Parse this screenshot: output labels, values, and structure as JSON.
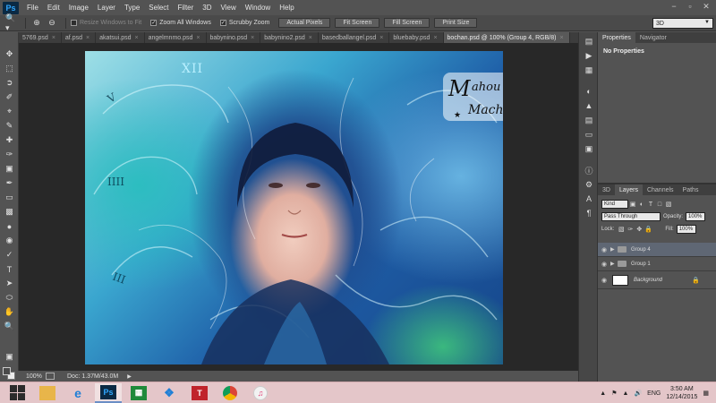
{
  "app": {
    "logo": "Ps",
    "menu": [
      "File",
      "Edit",
      "Image",
      "Layer",
      "Type",
      "Select",
      "Filter",
      "3D",
      "View",
      "Window",
      "Help"
    ],
    "window_controls": [
      "−",
      "▫",
      "✕"
    ]
  },
  "options_bar": {
    "resize_windows": "Resize Windows to Fit",
    "zoom_all_windows": "Zoom All Windows",
    "scrubby_zoom": "Scrubby Zoom",
    "actual_pixels": "Actual Pixels",
    "fit_screen": "Fit Screen",
    "fill_screen": "Fill Screen",
    "print_size": "Print Size",
    "workspace": "3D"
  },
  "tabs": [
    {
      "label": "5769.psd"
    },
    {
      "label": "af.psd"
    },
    {
      "label": "akatsui.psd"
    },
    {
      "label": "angelmnmo.psd"
    },
    {
      "label": "babynino.psd"
    },
    {
      "label": "babynino2.psd"
    },
    {
      "label": "basedballangel.psd"
    },
    {
      "label": "bluebaby.psd"
    },
    {
      "label": "bochan.psd @ 100% (Group 4, RGB/8)",
      "active": true
    }
  ],
  "artwork": {
    "numeral": "XII",
    "logo_lines": [
      "Mahou",
      "Machine"
    ]
  },
  "status": {
    "zoom": "100%",
    "doc": "Doc: 1.37M/43.0M"
  },
  "properties_panel": {
    "tabs": [
      "Properties",
      "Navigator"
    ],
    "message": "No Properties"
  },
  "layers_panel": {
    "tabs": [
      "3D",
      "Layers",
      "Channels",
      "Paths"
    ],
    "kind": "Kind",
    "blend_mode": "Pass Through",
    "opacity_label": "Opacity:",
    "opacity": "100%",
    "lock_label": "Lock:",
    "fill_label": "Fill:",
    "fill": "100%",
    "layers": [
      {
        "name": "Group 4",
        "type": "group",
        "selected": true
      },
      {
        "name": "Group 1",
        "type": "group",
        "selected": false
      },
      {
        "name": "Background",
        "type": "background",
        "selected": false
      }
    ]
  },
  "taskbar": {
    "apps": [
      "explorer",
      "internet-explorer",
      "photoshop",
      "spreadsheet",
      "dropbox",
      "tsuru",
      "chrome",
      "itunes"
    ],
    "language": "ENG",
    "time": "3:50 AM",
    "date": "12/14/2015"
  }
}
